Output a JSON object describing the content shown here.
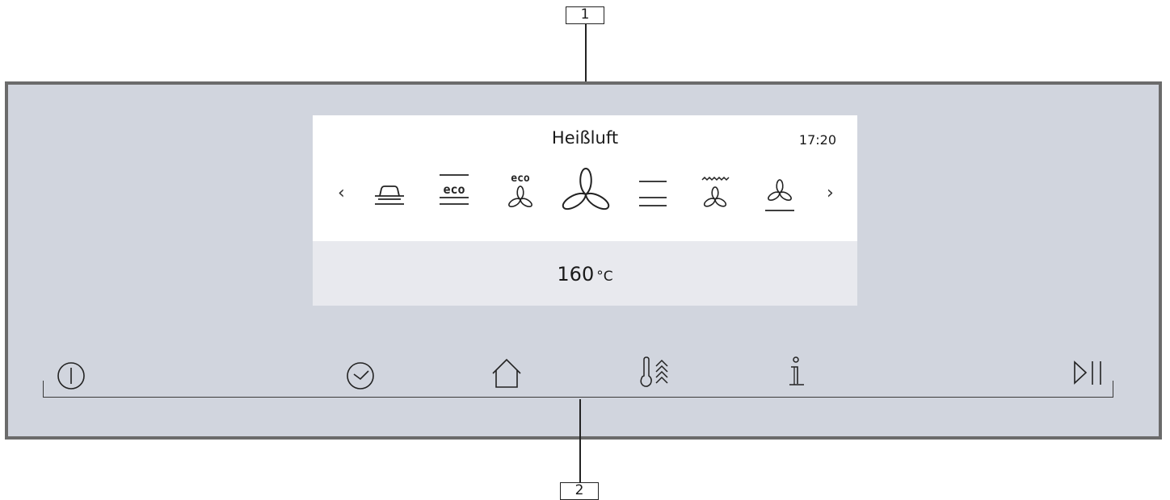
{
  "callouts": {
    "c1": "1",
    "c2": "2"
  },
  "display": {
    "mode_title": "Heißluft",
    "clock": "17:20",
    "temperature": "160",
    "temperature_unit": "°C",
    "nav_left": "‹",
    "nav_right": "›",
    "mode_icons": [
      "bake-tray-icon",
      "eco-heat-icon",
      "eco-fan-icon",
      "fan-heat-icon",
      "top-bottom-heat-icon",
      "grill-fan-icon",
      "fan-bottom-heat-icon"
    ]
  },
  "touch_controls": [
    "power-icon",
    "timer-icon",
    "home-icon",
    "temperature-steam-icon",
    "info-icon",
    "start-pause-icon"
  ],
  "colors": {
    "panel": "#d1d5de",
    "frame": "#6b6b6b",
    "display_bg": "#ffffff",
    "display_lower": "#e8e9ee"
  }
}
